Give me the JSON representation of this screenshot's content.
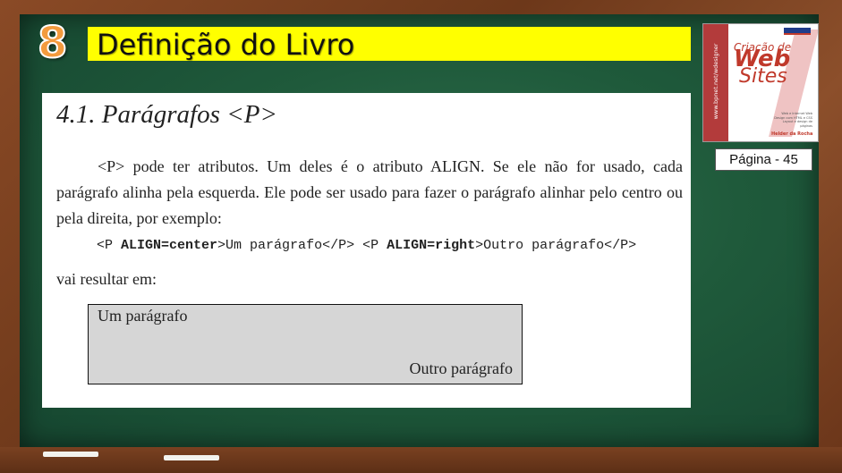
{
  "slide": {
    "number": "8",
    "title": "Definição do Livro"
  },
  "book": {
    "title_line1": "Criação de",
    "title_line2": "Web",
    "title_line3": "Sites",
    "spine_text": "www.bpnet.net/wdesigner",
    "small_text": "Web e Internet\nWeb Design com HTML e CSS\nLayout e design de páginas",
    "author": "Helder da Rocha"
  },
  "page_label": "Página - 45",
  "scan": {
    "section_title": "4.1.  Parágrafos <P>",
    "paragraph": "<P> pode ter atributos. Um deles é o atributo ALIGN. Se ele não for usado, cada parágrafo alinha pela esquerda. Ele pode ser usado para fazer o parágrafo alinhar pelo centro ou pela direita, por exemplo:",
    "code": {
      "part1": "<P ",
      "part2": "ALIGN=center",
      "part3": ">Um parágrafo</P> <P ",
      "part4": "ALIGN=right",
      "part5": ">Outro parágrafo</P>"
    },
    "result_label": "vai resultar em:",
    "demo_left": "Um parágrafo",
    "demo_right": "Outro parágrafo"
  },
  "colors": {
    "title_bar": "#ffff00",
    "board": "#1f5a3b",
    "frame": "#7a4121",
    "number": "#f39b3e"
  }
}
